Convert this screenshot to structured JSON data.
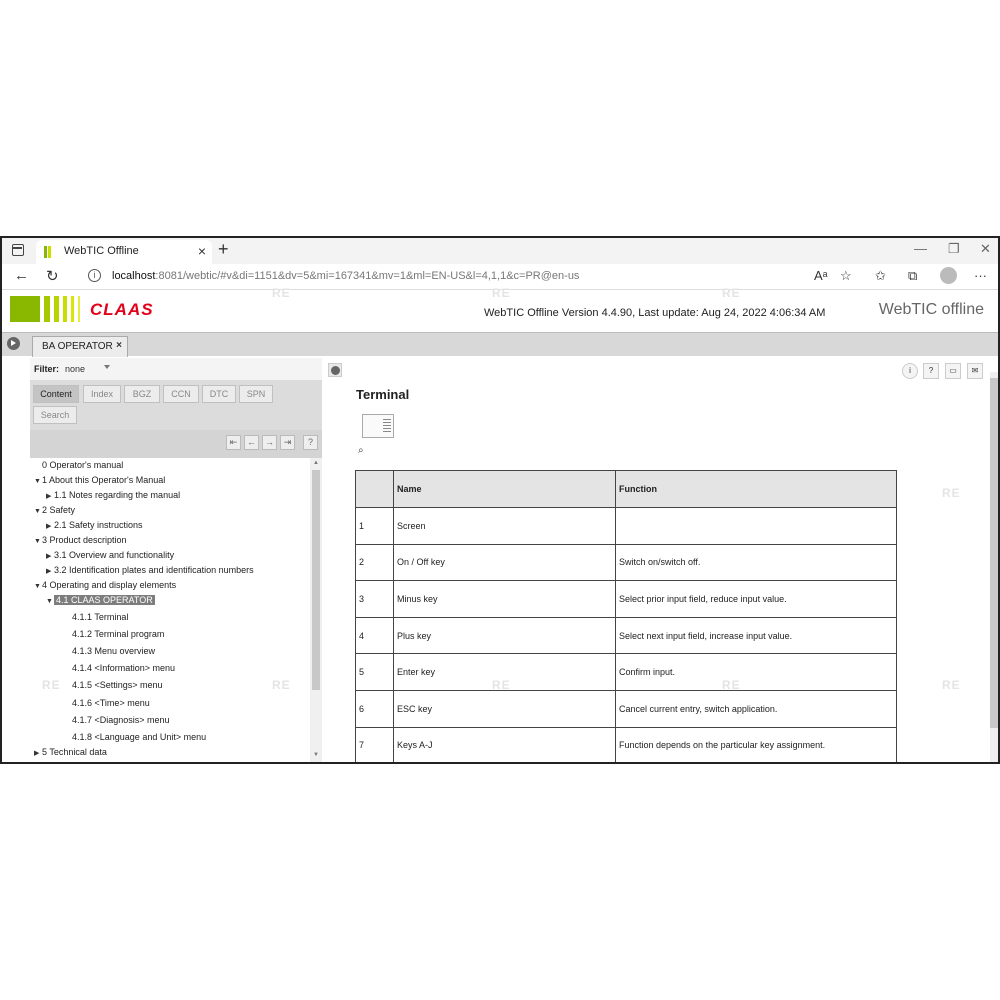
{
  "browser": {
    "tab_title": "WebTIC Offline",
    "url_host": "localhost",
    "url_rest": ":8081/webtic/#v&di=1151&dv=5&mi=167341&mv=1&ml=EN-US&l=4,1,1&c=PR@en-us"
  },
  "header": {
    "logo": "CLAAS",
    "version": "WebTIC Offline Version 4.4.90, Last update: Aug 24, 2022 4:06:34 AM",
    "brand": "WebTIC offline"
  },
  "doc_tab": {
    "label": "BA OPERATOR"
  },
  "filter": {
    "label": "Filter:",
    "value": "none"
  },
  "nav_tabs": [
    "Content",
    "Index",
    "BGZ",
    "CCN",
    "DTC",
    "SPN",
    "Search"
  ],
  "tree": [
    {
      "label": "0 Operator's manual",
      "level": 0,
      "arrow": ""
    },
    {
      "label": "1 About this Operator's Manual",
      "level": 0,
      "arrow": "down"
    },
    {
      "label": "1.1 Notes regarding the manual",
      "level": 1,
      "arrow": "right"
    },
    {
      "label": "2 Safety",
      "level": 0,
      "arrow": "down"
    },
    {
      "label": "2.1 Safety instructions",
      "level": 1,
      "arrow": "right"
    },
    {
      "label": "3 Product description",
      "level": 0,
      "arrow": "down"
    },
    {
      "label": "3.1 Overview and functionality",
      "level": 1,
      "arrow": "right"
    },
    {
      "label": "3.2 Identification plates and identification numbers",
      "level": 1,
      "arrow": "right"
    },
    {
      "label": "4 Operating and display elements",
      "level": 0,
      "arrow": "down"
    },
    {
      "label": "4.1 CLAAS OPERATOR",
      "level": 1,
      "arrow": "down",
      "selected": true
    },
    {
      "label": "4.1.1 Terminal",
      "level": 2,
      "arrow": ""
    },
    {
      "label": "4.1.2 Terminal program",
      "level": 2,
      "arrow": ""
    },
    {
      "label": "4.1.3 Menu overview",
      "level": 2,
      "arrow": ""
    },
    {
      "label": "4.1.4 <Information> menu",
      "level": 2,
      "arrow": ""
    },
    {
      "label": "4.1.5 <Settings> menu",
      "level": 2,
      "arrow": ""
    },
    {
      "label": "4.1.6 <Time> menu",
      "level": 2,
      "arrow": ""
    },
    {
      "label": "4.1.7 <Diagnosis> menu",
      "level": 2,
      "arrow": ""
    },
    {
      "label": "4.1.8 <Language and Unit> menu",
      "level": 2,
      "arrow": ""
    },
    {
      "label": "5 Technical data",
      "level": 0,
      "arrow": "right"
    }
  ],
  "content": {
    "title": "Terminal",
    "table": {
      "headers": [
        "",
        "Name",
        "Function"
      ],
      "rows": [
        [
          "1",
          "Screen",
          ""
        ],
        [
          "2",
          "On / Off key",
          "Switch on/switch off."
        ],
        [
          "3",
          "Minus key",
          "Select prior input field, reduce input value."
        ],
        [
          "4",
          "Plus key",
          "Select next input field, increase input value."
        ],
        [
          "5",
          "Enter key",
          "Confirm input."
        ],
        [
          "6",
          "ESC key",
          "Cancel current entry, switch application."
        ],
        [
          "7",
          "Keys A-J",
          "Function depends on the particular key assignment."
        ]
      ]
    }
  },
  "colors": {
    "claas_red": "#e2001a",
    "claas_green": "#8ab800",
    "selection": "#7d7d7d"
  },
  "icons": [
    "back-icon",
    "reload-icon",
    "info-icon",
    "help-icon",
    "print-icon",
    "mail-icon",
    "zoom-icon"
  ]
}
